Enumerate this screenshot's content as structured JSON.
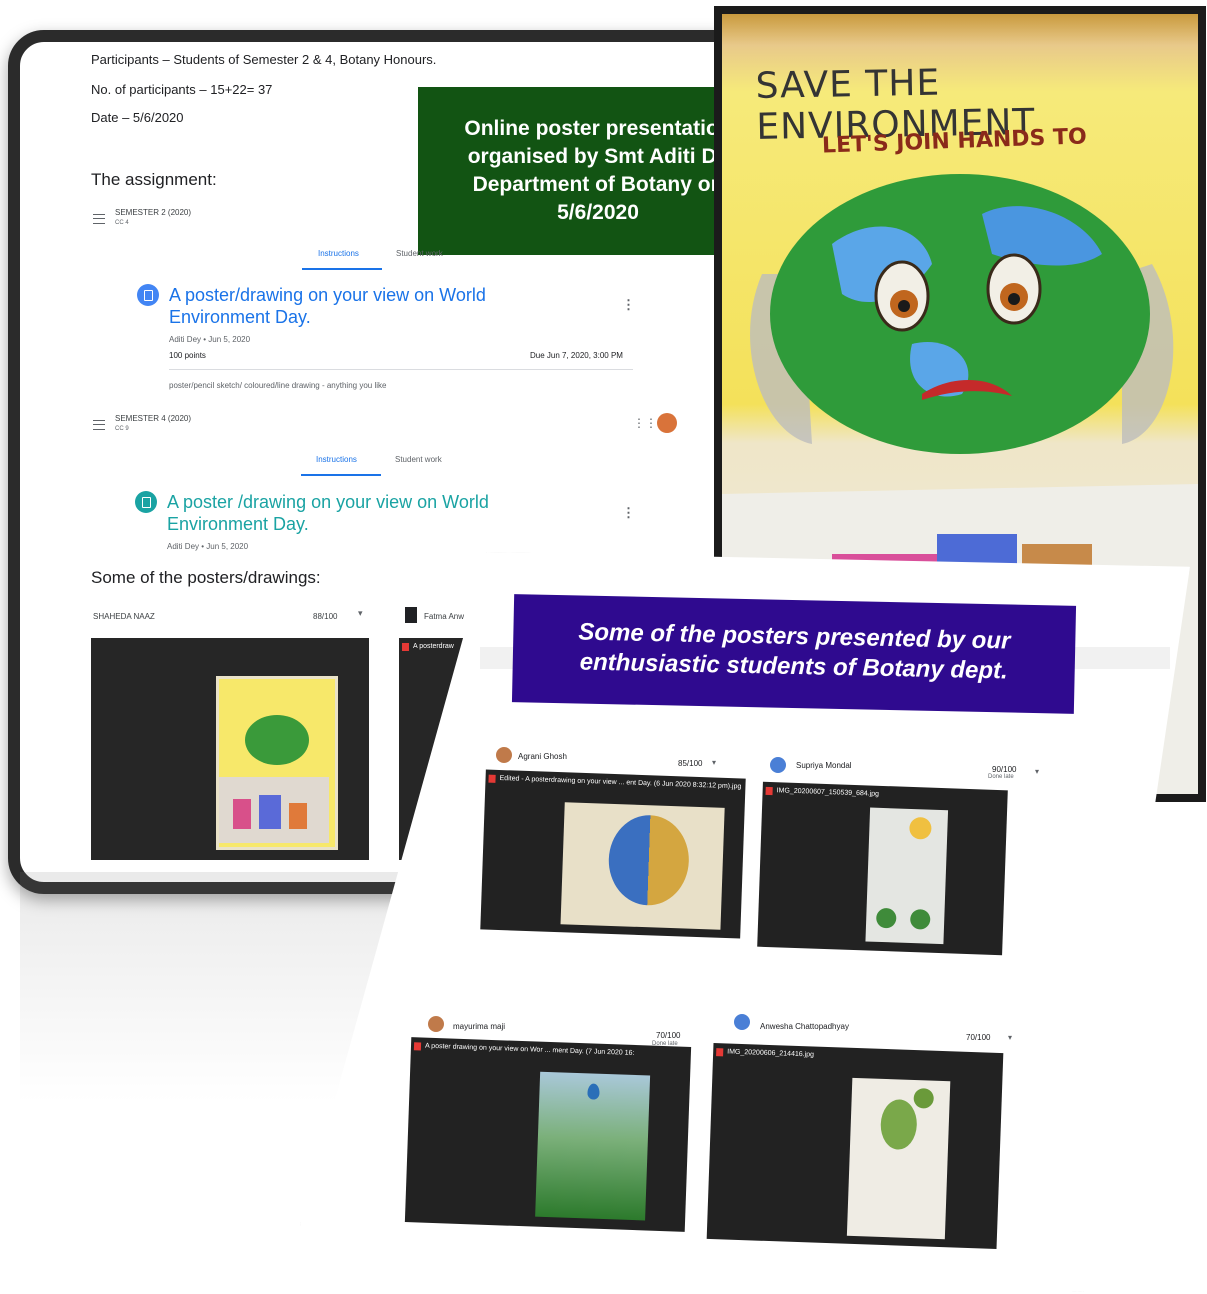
{
  "summary": {
    "participants": "Participants – Students of Semester 2 & 4, Botany Honours.",
    "count": "No. of participants – 15+22= 37",
    "date": "Date – 5/6/2020",
    "assignment_heading": "The assignment:",
    "banner_lines": [
      "Online poster presentation",
      "organised by Smt Aditi De",
      "Department of Botany on",
      "5/6/2020"
    ],
    "posters_heading": "Some of the posters/drawings:"
  },
  "classes": [
    {
      "name": "SEMESTER 2 (2020)",
      "code": "CC 4",
      "tabs": [
        "Instructions",
        "Student work"
      ],
      "assignment_title": "A poster/drawing on your view on World Environment Day.",
      "meta": "Aditi Dey • Jun 5, 2020",
      "points": "100 points",
      "due": "Due Jun 7, 2020, 3:00 PM",
      "description": "poster/pencil sketch/ coloured/line drawing - anything you like"
    },
    {
      "name": "SEMESTER 4 (2020)",
      "code": "CC 9",
      "tabs": [
        "Instructions",
        "Student work"
      ],
      "assignment_title": "A poster /drawing on your view on World Environment Day.",
      "meta": "Aditi Dey • Jun 5, 2020"
    }
  ],
  "submissions_row1": {
    "student_name": "SHAHEDA NAAZ",
    "grade": "88/100",
    "second_student": "Fatma Anw",
    "second_file": "A posterdraw"
  },
  "poster_photo": {
    "title": "SAVE THE ENVIRONMENT",
    "subtitle": "LET'S JOIN HANDS TO"
  },
  "gallery": {
    "banner_lines": [
      "Some of the posters presented by our",
      "enthusiastic students of Botany dept."
    ],
    "items": [
      {
        "student": "Agrani Ghosh",
        "grade": "85/100",
        "status": "",
        "file": "Edited - A posterdrawing on your view ... ent Day. (6 Jun 2020 8:32:12 pm).jpg"
      },
      {
        "student": "Supriya Mondal",
        "grade": "90/100",
        "status": "Done late",
        "file": "IMG_20200607_150539_684.jpg"
      },
      {
        "student": "mayurima maji",
        "grade": "70/100",
        "status": "Done late",
        "file": "A poster drawing on your view on Wor ... ment Day. (7 Jun 2020 16:"
      },
      {
        "student": "Anwesha Chattopadhyay",
        "grade": "70/100",
        "status": "",
        "file": "IMG_20200606_214416.jpg"
      }
    ]
  },
  "colors": {
    "green_banner": "#125413",
    "purple_banner": "#2f0a8f",
    "classroom_blue": "#1a73e8",
    "teal": "#1aa3a3"
  }
}
